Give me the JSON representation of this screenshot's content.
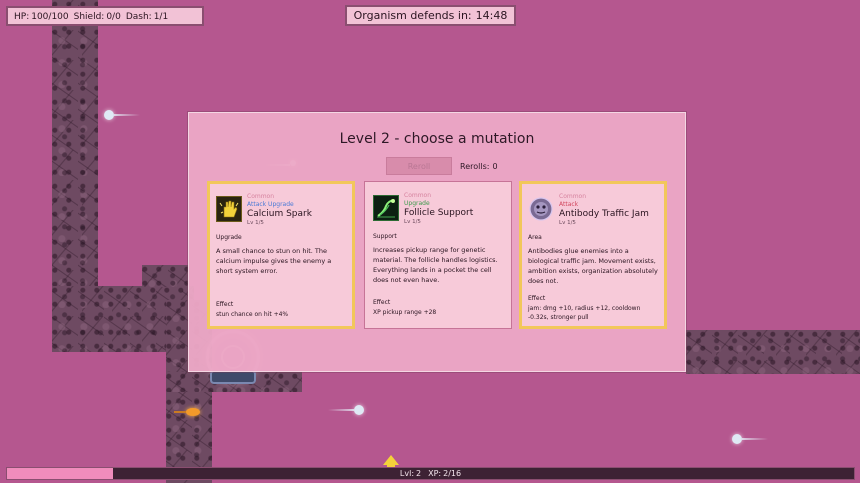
{
  "hud": {
    "hp_label": "HP:",
    "hp_value": "100/100",
    "shield_label": "Shield:",
    "shield_value": "0/0",
    "dash_label": "Dash:",
    "dash_value": "1/1",
    "timer_label": "Organism defends in:",
    "timer_value": "14:48"
  },
  "xp": {
    "level_label": "Lvl:",
    "level_value": "2",
    "xp_label": "XP:",
    "xp_value": "2/16",
    "progress": 0.125
  },
  "modal": {
    "title": "Level 2 - choose a mutation",
    "reroll_label": "Reroll",
    "rerolls_label": "Rerolls:",
    "rerolls_value": "0",
    "cards": [
      {
        "rarity": "Common",
        "type": "Attack Upgrade",
        "type_color": "#4a7ad6",
        "name": "Calcium Spark",
        "level": "Lv 1/5",
        "tag": "Upgrade",
        "description": "A small chance to stun on hit. The calcium impulse gives the enemy a short system error.",
        "effect_label": "Effect",
        "effect": "stun chance on hit +4%",
        "icon": "calcium-hand-icon"
      },
      {
        "rarity": "Common",
        "type": "Upgrade",
        "type_color": "#3c9a4c",
        "name": "Follicle Support",
        "level": "Lv 1/5",
        "tag": "Support",
        "description": "Increases pickup range for genetic material. The follicle handles logistics. Everything lands in a pocket the cell does not even have.",
        "effect_label": "Effect",
        "effect": "XP pickup range +28",
        "icon": "follicle-icon"
      },
      {
        "rarity": "Common",
        "type": "Attack",
        "type_color": "#d2475e",
        "name": "Antibody Traffic Jam",
        "level": "Lv 1/5",
        "tag": "Area",
        "description": "Antibodies glue enemies into a biological traffic jam. Movement exists, ambition exists, organization absolutely does not.",
        "effect_label": "Effect",
        "effect": "jam: dmg +10, radius +12, cooldown -0.32s, stronger pull",
        "icon": "antibody-icon"
      }
    ]
  }
}
